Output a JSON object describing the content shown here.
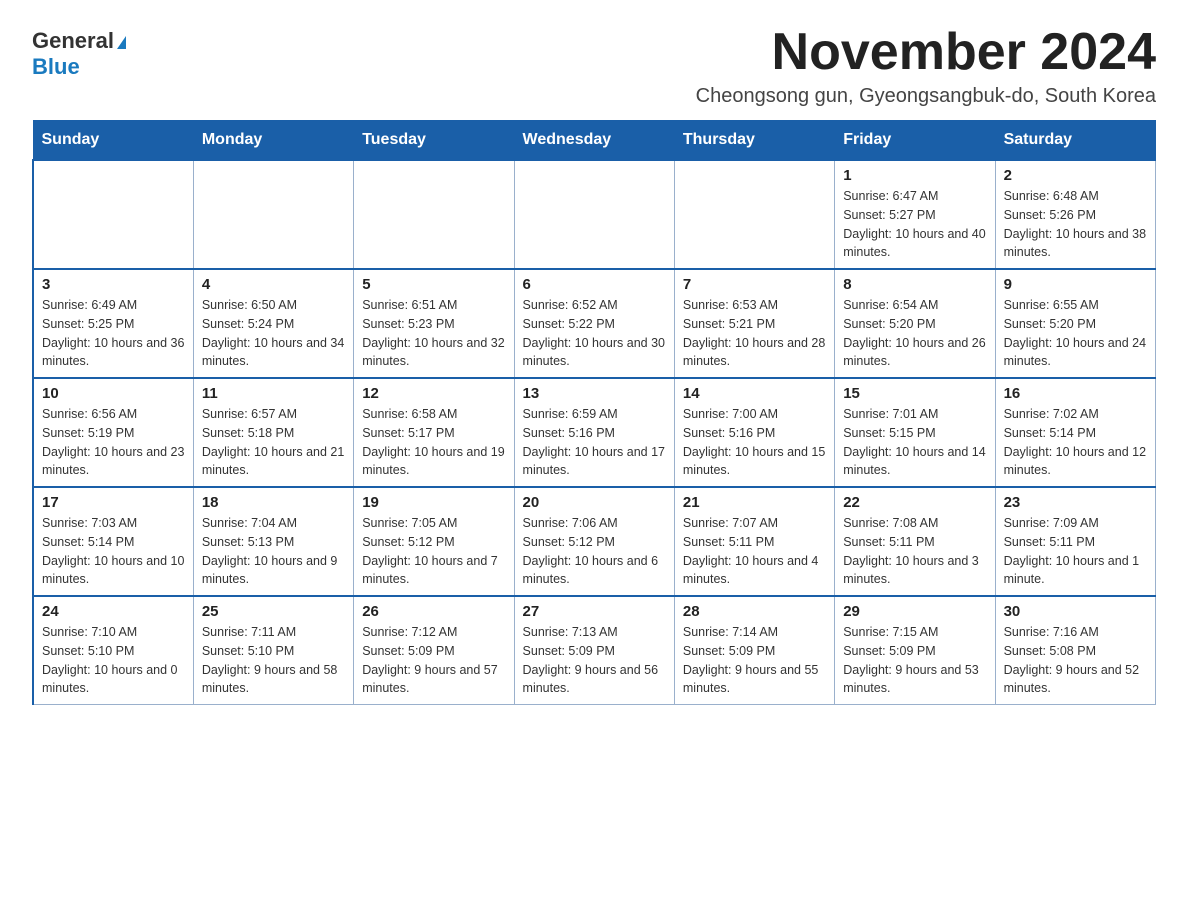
{
  "logo": {
    "general": "General",
    "triangle": "▶",
    "blue": "Blue"
  },
  "title": "November 2024",
  "subtitle": "Cheongsong gun, Gyeongsangbuk-do, South Korea",
  "weekdays": [
    "Sunday",
    "Monday",
    "Tuesday",
    "Wednesday",
    "Thursday",
    "Friday",
    "Saturday"
  ],
  "weeks": [
    [
      {
        "day": "",
        "info": ""
      },
      {
        "day": "",
        "info": ""
      },
      {
        "day": "",
        "info": ""
      },
      {
        "day": "",
        "info": ""
      },
      {
        "day": "",
        "info": ""
      },
      {
        "day": "1",
        "info": "Sunrise: 6:47 AM\nSunset: 5:27 PM\nDaylight: 10 hours and 40 minutes."
      },
      {
        "day": "2",
        "info": "Sunrise: 6:48 AM\nSunset: 5:26 PM\nDaylight: 10 hours and 38 minutes."
      }
    ],
    [
      {
        "day": "3",
        "info": "Sunrise: 6:49 AM\nSunset: 5:25 PM\nDaylight: 10 hours and 36 minutes."
      },
      {
        "day": "4",
        "info": "Sunrise: 6:50 AM\nSunset: 5:24 PM\nDaylight: 10 hours and 34 minutes."
      },
      {
        "day": "5",
        "info": "Sunrise: 6:51 AM\nSunset: 5:23 PM\nDaylight: 10 hours and 32 minutes."
      },
      {
        "day": "6",
        "info": "Sunrise: 6:52 AM\nSunset: 5:22 PM\nDaylight: 10 hours and 30 minutes."
      },
      {
        "day": "7",
        "info": "Sunrise: 6:53 AM\nSunset: 5:21 PM\nDaylight: 10 hours and 28 minutes."
      },
      {
        "day": "8",
        "info": "Sunrise: 6:54 AM\nSunset: 5:20 PM\nDaylight: 10 hours and 26 minutes."
      },
      {
        "day": "9",
        "info": "Sunrise: 6:55 AM\nSunset: 5:20 PM\nDaylight: 10 hours and 24 minutes."
      }
    ],
    [
      {
        "day": "10",
        "info": "Sunrise: 6:56 AM\nSunset: 5:19 PM\nDaylight: 10 hours and 23 minutes."
      },
      {
        "day": "11",
        "info": "Sunrise: 6:57 AM\nSunset: 5:18 PM\nDaylight: 10 hours and 21 minutes."
      },
      {
        "day": "12",
        "info": "Sunrise: 6:58 AM\nSunset: 5:17 PM\nDaylight: 10 hours and 19 minutes."
      },
      {
        "day": "13",
        "info": "Sunrise: 6:59 AM\nSunset: 5:16 PM\nDaylight: 10 hours and 17 minutes."
      },
      {
        "day": "14",
        "info": "Sunrise: 7:00 AM\nSunset: 5:16 PM\nDaylight: 10 hours and 15 minutes."
      },
      {
        "day": "15",
        "info": "Sunrise: 7:01 AM\nSunset: 5:15 PM\nDaylight: 10 hours and 14 minutes."
      },
      {
        "day": "16",
        "info": "Sunrise: 7:02 AM\nSunset: 5:14 PM\nDaylight: 10 hours and 12 minutes."
      }
    ],
    [
      {
        "day": "17",
        "info": "Sunrise: 7:03 AM\nSunset: 5:14 PM\nDaylight: 10 hours and 10 minutes."
      },
      {
        "day": "18",
        "info": "Sunrise: 7:04 AM\nSunset: 5:13 PM\nDaylight: 10 hours and 9 minutes."
      },
      {
        "day": "19",
        "info": "Sunrise: 7:05 AM\nSunset: 5:12 PM\nDaylight: 10 hours and 7 minutes."
      },
      {
        "day": "20",
        "info": "Sunrise: 7:06 AM\nSunset: 5:12 PM\nDaylight: 10 hours and 6 minutes."
      },
      {
        "day": "21",
        "info": "Sunrise: 7:07 AM\nSunset: 5:11 PM\nDaylight: 10 hours and 4 minutes."
      },
      {
        "day": "22",
        "info": "Sunrise: 7:08 AM\nSunset: 5:11 PM\nDaylight: 10 hours and 3 minutes."
      },
      {
        "day": "23",
        "info": "Sunrise: 7:09 AM\nSunset: 5:11 PM\nDaylight: 10 hours and 1 minute."
      }
    ],
    [
      {
        "day": "24",
        "info": "Sunrise: 7:10 AM\nSunset: 5:10 PM\nDaylight: 10 hours and 0 minutes."
      },
      {
        "day": "25",
        "info": "Sunrise: 7:11 AM\nSunset: 5:10 PM\nDaylight: 9 hours and 58 minutes."
      },
      {
        "day": "26",
        "info": "Sunrise: 7:12 AM\nSunset: 5:09 PM\nDaylight: 9 hours and 57 minutes."
      },
      {
        "day": "27",
        "info": "Sunrise: 7:13 AM\nSunset: 5:09 PM\nDaylight: 9 hours and 56 minutes."
      },
      {
        "day": "28",
        "info": "Sunrise: 7:14 AM\nSunset: 5:09 PM\nDaylight: 9 hours and 55 minutes."
      },
      {
        "day": "29",
        "info": "Sunrise: 7:15 AM\nSunset: 5:09 PM\nDaylight: 9 hours and 53 minutes."
      },
      {
        "day": "30",
        "info": "Sunrise: 7:16 AM\nSunset: 5:08 PM\nDaylight: 9 hours and 52 minutes."
      }
    ]
  ]
}
